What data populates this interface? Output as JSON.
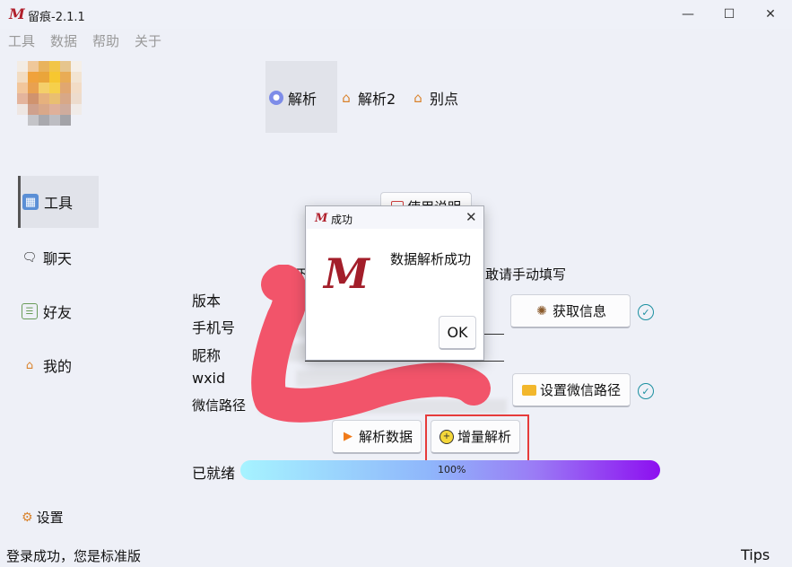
{
  "window": {
    "title": "留痕-2.1.1",
    "logo_letter": "M",
    "minimize": "—",
    "maximize": "☐",
    "close": "✕"
  },
  "menu": [
    "工具",
    "数据",
    "帮助",
    "关于"
  ],
  "nav": {
    "tools": "工具",
    "chat": "聊天",
    "friends": "好友",
    "mine": "我的",
    "settings": "设置"
  },
  "tabs": [
    "解析",
    "解析2",
    "别点"
  ],
  "form": {
    "version_label": "版本",
    "phone_label": "手机号",
    "nick_label": "昵称",
    "wxid_label": "wxid",
    "path_label": "微信路径",
    "hint_left": "以下",
    "hint_right": "敢请手动填写"
  },
  "buttons": {
    "get_info": "获取信息",
    "set_path": "设置微信路径",
    "parse_data": "解析数据",
    "incremental": "增量解析",
    "usage": "使用说明"
  },
  "progress": {
    "label": "已就绪",
    "value": 100,
    "text": "100%"
  },
  "dialog": {
    "title": "成功",
    "message": "数据解析成功",
    "ok": "OK",
    "logo_letter": "M",
    "close": "✕"
  },
  "status": {
    "left": "登录成功，您是标准版",
    "right": "Tips"
  },
  "colors": {
    "accent_red": "#e63b3b",
    "scribble": "#f2546a",
    "brand": "#b0202c",
    "check": "#1a8fa0"
  }
}
